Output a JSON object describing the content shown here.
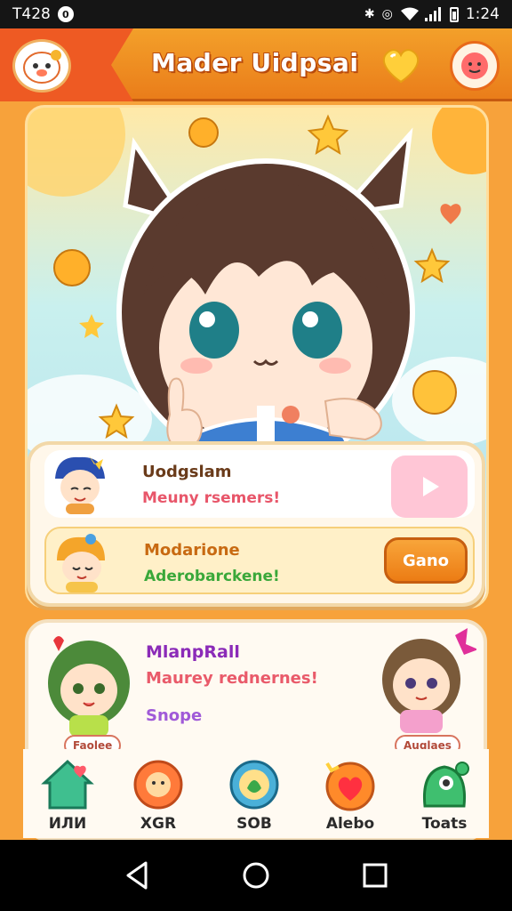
{
  "status_bar": {
    "left_text": "T428",
    "left_badge": "0",
    "time": "1:24"
  },
  "header": {
    "title": "Mader Uidpsai",
    "accent": "#ee5a23",
    "bg": "#f3a02a"
  },
  "hero": {
    "alt_icon": "anime-girl-illustration"
  },
  "list_card": {
    "rows": [
      {
        "name": "Uodgslam",
        "subtitle": "Meuny rsemers!",
        "button_icon": "play-icon"
      },
      {
        "name": "Modarione",
        "subtitle": "Aderobarckene!",
        "button_label": "Gano"
      }
    ]
  },
  "feature_card": {
    "title": "MlanpRall",
    "subtitle": "Maurey rednernes!",
    "tag": "Snope",
    "left_char_label": "Faolee",
    "right_char_label": "Auglaes"
  },
  "bottom_nav": {
    "items": [
      {
        "label": "ИЛИ",
        "icon": "home-icon"
      },
      {
        "label": "XGR",
        "icon": "friends-icon"
      },
      {
        "label": "SOB",
        "icon": "shop-icon"
      },
      {
        "label": "Alebo",
        "icon": "heart-icon"
      },
      {
        "label": "Toats",
        "icon": "creature-icon"
      }
    ]
  }
}
